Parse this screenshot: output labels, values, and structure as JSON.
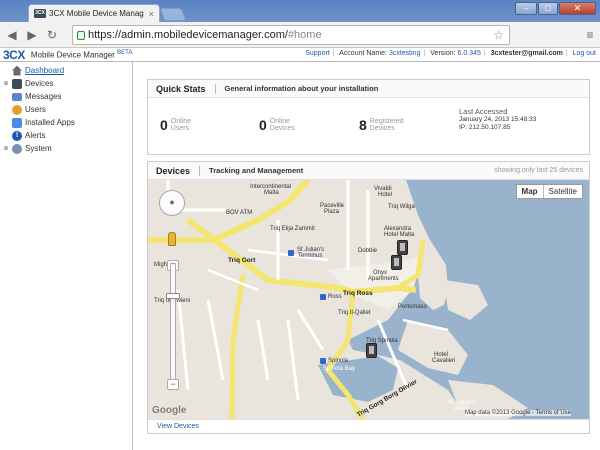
{
  "browser": {
    "tab_title": "3CX Mobile Device Manag",
    "tab_icon": "3CX",
    "url_main": "https://admin.mobiledevicemanager.com/",
    "url_hash": "#home"
  },
  "app": {
    "logo": "3CX",
    "name": "Mobile Device Manager",
    "beta": "BETA",
    "support": "Support",
    "account_label": "Account Name:",
    "account_value": "3cxtesting",
    "version_label": "Version:",
    "version_value": "6.0.345",
    "user_email": "3cxtester@gmail.com",
    "logout": "Log out"
  },
  "sidebar": {
    "items": [
      {
        "label": "Dashboard",
        "icon": "home-icon",
        "color": "#6a6a6a"
      },
      {
        "label": "Devices",
        "icon": "devices-icon",
        "color": "#3f4b5a"
      },
      {
        "label": "Messages",
        "icon": "messages-icon",
        "color": "#5a86c8"
      },
      {
        "label": "Users",
        "icon": "users-icon",
        "color": "#e0a030"
      },
      {
        "label": "Installed Apps",
        "icon": "apps-icon",
        "color": "#4a8de0"
      },
      {
        "label": "Alerts",
        "icon": "alert-icon",
        "color": "#1a5aa8"
      },
      {
        "label": "System",
        "icon": "gear-icon",
        "color": "#7a8fb0"
      }
    ]
  },
  "quick_stats": {
    "title": "Quick Stats",
    "subtitle": "General information about your installation",
    "online_users_value": "0",
    "online_users_line1": "Online",
    "online_users_line2": "Users",
    "online_devices_value": "0",
    "online_devices_line1": "Online",
    "online_devices_line2": "Devices",
    "registered_value": "8",
    "registered_line1": "Registered",
    "registered_line2": "Devices",
    "last_accessed_label": "Last Accessed",
    "last_accessed_date": "January 24, 2013 15:48:33",
    "last_accessed_ip": "IP: 212.50.107.85"
  },
  "devices_panel": {
    "title": "Devices",
    "subtitle": "Tracking and Management",
    "note": "showing only last 25 devices",
    "map_button": "Map",
    "satellite_button": "Satellite",
    "view_link": "View Devices",
    "map_data": "Map data ©2013 Google - Terms of Use",
    "google": "Google"
  },
  "map_labels": {
    "intercontinental": "Intercontinental",
    "malta": "Malta",
    "paceville": "Paceville",
    "plaza": "Plaza",
    "vivaldi": "Vivaldi",
    "hotel": "Hotel",
    "bov": "BOV ATM",
    "triq_paceville": "Triq Paceville",
    "triq_wilga": "Triq Wilga",
    "alexandra": "Alexandra",
    "alexandra_hotel": "Hotel Malta",
    "dobbie": "Dobbie",
    "triq_gort": "Triq Gort",
    "st_julians": "St Julian's",
    "terminus": "Terminus",
    "triq_ross": "Triq Ross",
    "ross": "Ross",
    "portomaso": "Portomaso",
    "onyx": "Onyx",
    "apartments": "Apartments",
    "triq_spinola": "Triq Spinola",
    "spinola": "Spinola",
    "spinola_bay": "Spinola Bay",
    "hotel_cavalieri": "Hotel",
    "cavalieri": "Cavalieri",
    "st_julians_pt": "St Julian's",
    "point": "Point",
    "triq_gorg_borg": "Triq Gorg Borg Olivier",
    "triq_elija": "Triq Elija Zammit",
    "mighed": "Mighed",
    "triq_ix_xwieni": "Triq Ix-Xwieni",
    "triq_il_qaliet": "Triq Il-Qaliet"
  }
}
